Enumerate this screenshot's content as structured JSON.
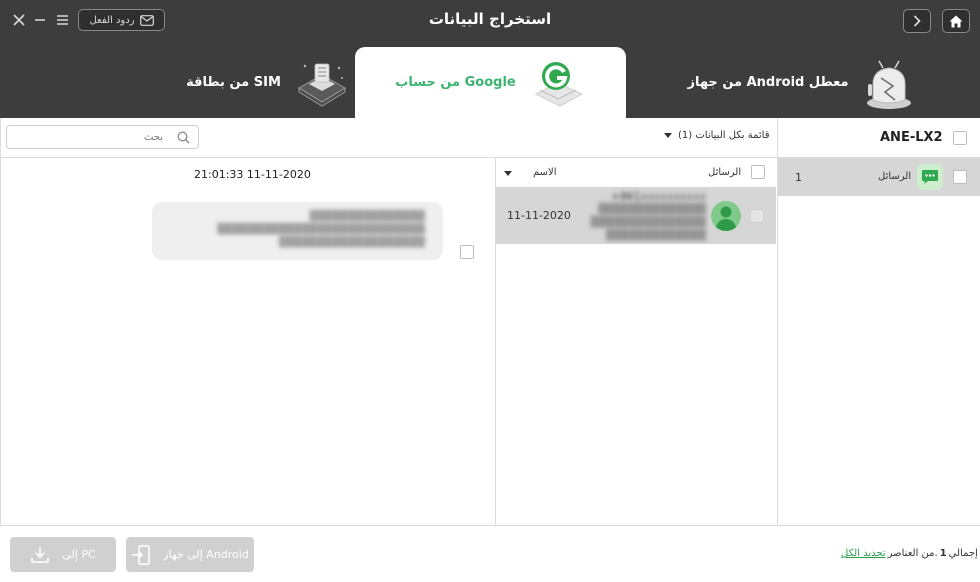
{
  "header": {
    "title": "استخراج البيانات",
    "feedback_label": "ردود الفعل",
    "tabs": [
      {
        "label": "من جهاز Android معطل",
        "icon": "broken-android-icon",
        "active": false
      },
      {
        "label": "من حساب Google",
        "icon": "google-account-icon",
        "active": true
      },
      {
        "label": "من بطاقة SIM",
        "icon": "sim-card-icon",
        "active": false
      }
    ]
  },
  "toolbar": {
    "search_placeholder": "بحث",
    "filter_label": "قائمة بكل البيانات (1)"
  },
  "device": {
    "name": "ANE-LX2",
    "categories": [
      {
        "label": "الرسائل",
        "count": "1",
        "icon": "message-icon"
      }
    ]
  },
  "message_list": {
    "header_messages": "الرسائل",
    "header_name": "الاسم",
    "rows": [
      {
        "phone": "+861",
        "date": "11-11-2020"
      }
    ]
  },
  "conversation": {
    "timestamp": "21:01:33 11-11-2020"
  },
  "footer": {
    "select_all": "تحديد الكل",
    "total_prefix": "إجمالي",
    "total_count": "1",
    "total_suffix": "من العناصر.",
    "to_android_label": "إلى جهاز Android",
    "to_pc_label": "إلى PC"
  },
  "colors": {
    "header_bg": "#3d3d3d",
    "accent_green": "#3cb371",
    "selected_row": "#d6d6d6",
    "disabled_button": "#d0d0d0"
  }
}
